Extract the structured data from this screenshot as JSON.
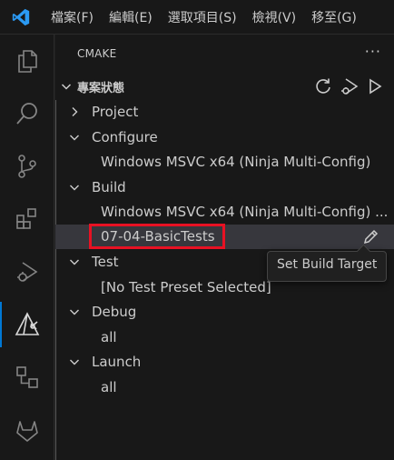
{
  "menu": [
    "檔案(F)",
    "編輯(E)",
    "選取項目(S)",
    "檢視(V)",
    "移至(G)"
  ],
  "activity_icons": [
    "explorer-icon",
    "search-icon",
    "source-control-icon",
    "extensions-icon",
    "run-debug-icon",
    "cmake-icon",
    "remote-explorer-icon",
    "gitlab-icon"
  ],
  "sidebar": {
    "title": "CMAKE",
    "more": "···",
    "section_title": "專案狀態",
    "header_actions": [
      "refresh-icon",
      "debug-run-icon",
      "run-icon"
    ]
  },
  "tree": {
    "project": "Project",
    "configure": "Configure",
    "configure_preset": "Windows MSVC x64 (Ninja Multi-Config)",
    "build": "Build",
    "build_preset": "Windows MSVC x64 (Ninja Multi-Config) ...",
    "build_target": "07-04-BasicTests",
    "test": "Test",
    "test_preset": "[No Test Preset Selected]",
    "debug": "Debug",
    "debug_target": "all",
    "launch": "Launch",
    "launch_target": "all"
  },
  "tooltip": "Set Build Target",
  "colors": {
    "accent": "#0078d4",
    "highlight_box": "#e81123",
    "selected_row": "#37373d"
  }
}
